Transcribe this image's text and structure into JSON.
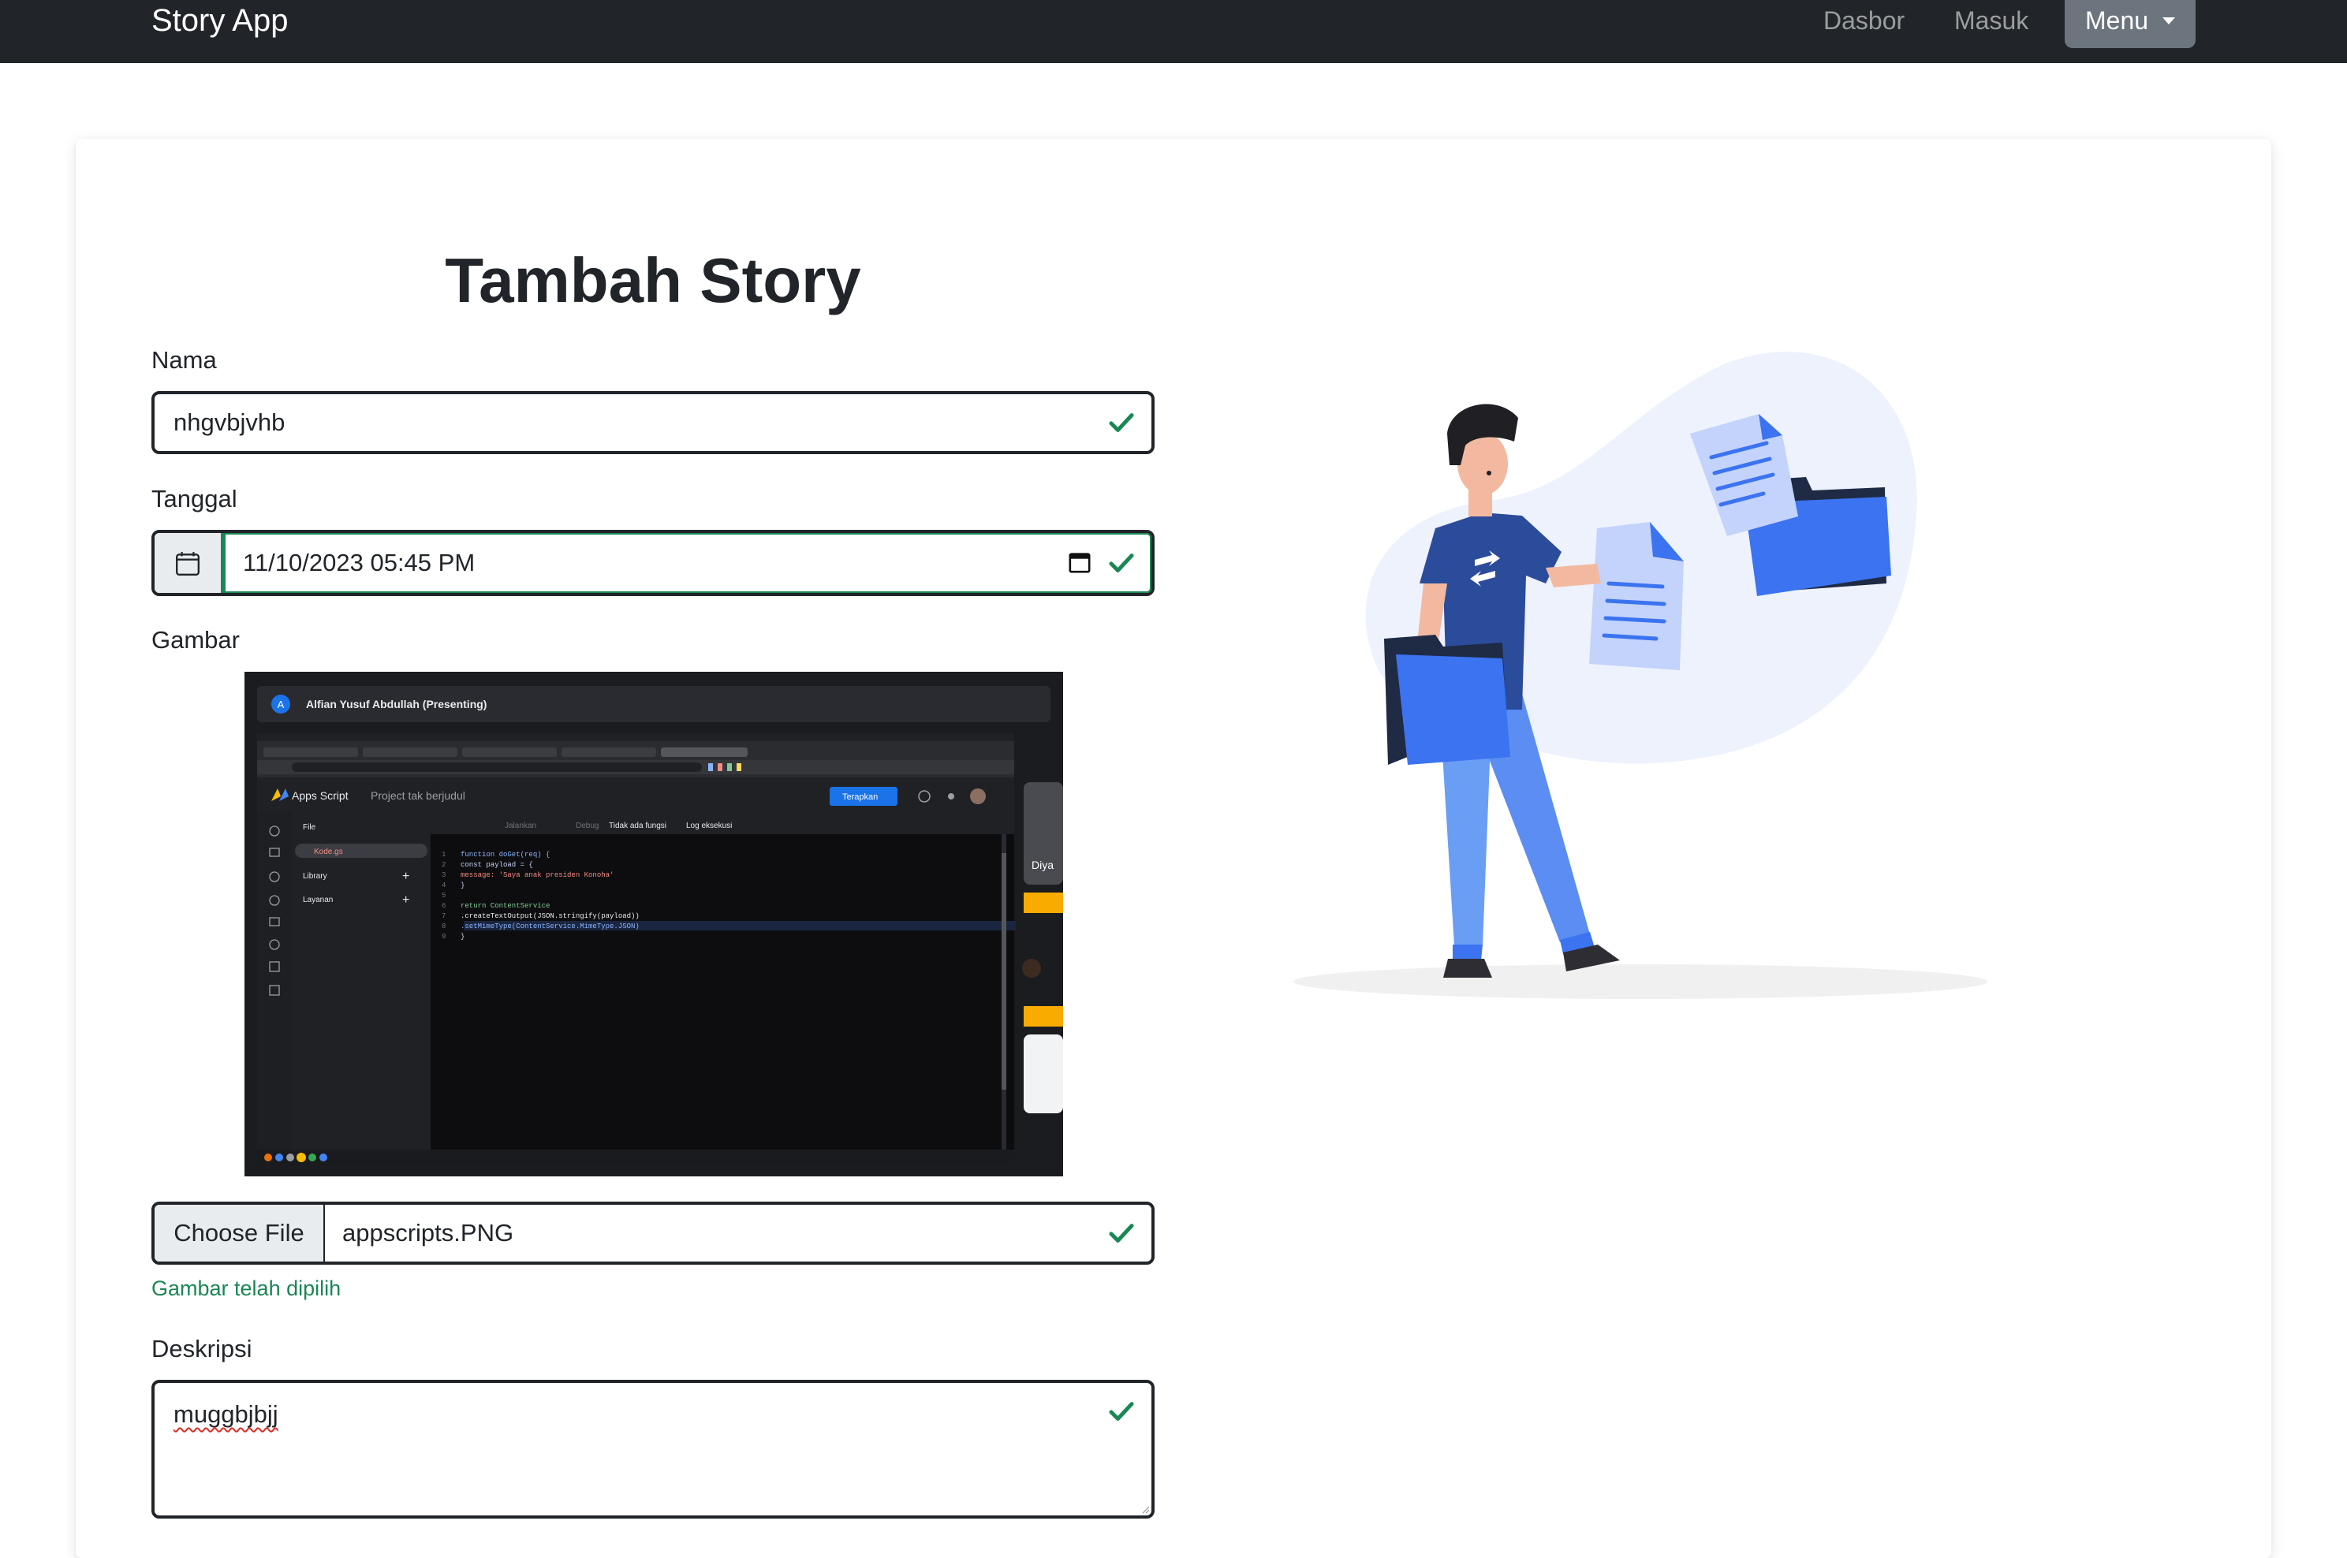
{
  "navbar": {
    "brand": "Story App",
    "links": [
      "Dasbor",
      "Masuk"
    ],
    "menu_label": "Menu"
  },
  "form": {
    "title": "Tambah Story",
    "nama": {
      "label": "Nama",
      "value": "nhgvbjvhb"
    },
    "tanggal": {
      "label": "Tanggal",
      "value": "11/10/2023 05:45  PM"
    },
    "gambar": {
      "label": "Gambar",
      "choose_label": "Choose File",
      "file_name": "appscripts.PNG",
      "valid_message": "Gambar telah dipilih"
    },
    "deskripsi": {
      "label": "Deskripsi",
      "value": "muggbjbjj"
    }
  },
  "preview_image": {
    "presenter": "Alfian Yusuf Abdullah (Presenting)",
    "app_name": "Apps Script",
    "project": "Project tak berjudul",
    "deploy_button": "Terapkan",
    "toolbar": [
      "Jalankan",
      "Debug",
      "Tidak ada fungsi",
      "Log eksekusi"
    ],
    "sidebar": {
      "file_header": "File",
      "file": "Kode.gs",
      "library": "Library",
      "services": "Layanan"
    },
    "code_lines": [
      "function doGet(req) {",
      "  const payload = {",
      "    message: 'Saya anak presiden Konoha'",
      "  }",
      "",
      "  return ContentService",
      "  .createTextOutput(JSON.stringify(payload))",
      "  .setMimeType(ContentService.MimeType.JSON)",
      "}"
    ],
    "side_tile_name": "Diya"
  },
  "colors": {
    "navbar": "#212529",
    "valid": "#198754",
    "menu_button": "#6c757d",
    "illustration_blue": "#3b73f0"
  }
}
